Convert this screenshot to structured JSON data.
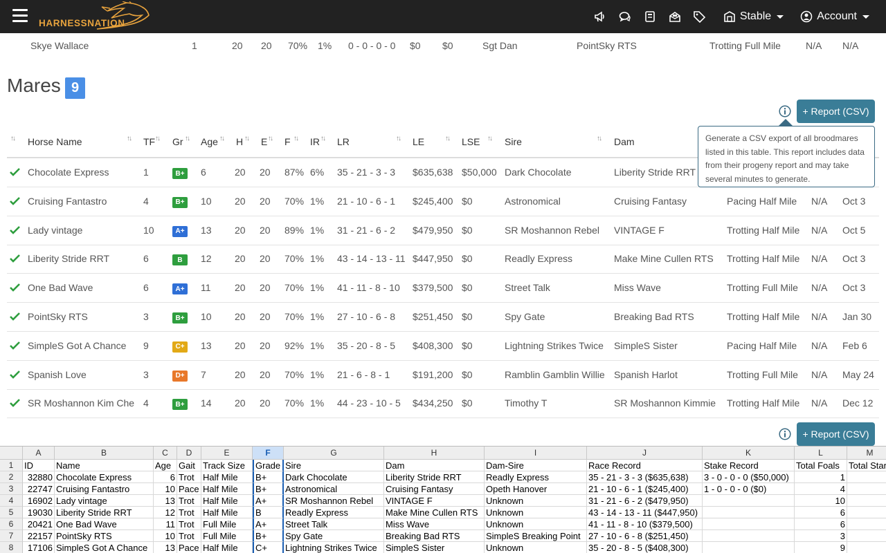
{
  "nav": {
    "logo_text": "HARNESSNATION",
    "stable_label": "Stable",
    "account_label": "Account",
    "icons": [
      "megaphone-icon",
      "chat-icon",
      "notes-icon",
      "inbox-icon",
      "tags-icon",
      "stable-icon",
      "account-icon"
    ]
  },
  "prev_row": {
    "name": "Skye Wallace",
    "tf": "1",
    "h": "20",
    "e": "20",
    "f": "70%",
    "ir": "1%",
    "lr": "0 - 0 - 0 - 0",
    "le": "$0",
    "lse": "$0",
    "sire": "Sgt Dan",
    "dam": "PointSky RTS",
    "track": "Trotting Full Mile",
    "c1": "N/A",
    "c2": "N/A"
  },
  "section": {
    "title": "Mares",
    "count": "9"
  },
  "report_button": "+ Report (CSV)",
  "tooltip": "Generate a CSV export of all broodmares listed in this table. This report includes data from their progeny report and may take several minutes to generate.",
  "columns": [
    "Horse Name",
    "TF",
    "Gr",
    "Age",
    "H",
    "E",
    "F",
    "IR",
    "LR",
    "LE",
    "LSE",
    "Sire",
    "Dam"
  ],
  "grade_colors": {
    "B+": "#2e9e3e",
    "B": "#2e9e3e",
    "A+": "#2f6fd6",
    "C+": "#e2a917",
    "D+": "#e8782a"
  },
  "rows": [
    {
      "name": "Chocolate Express",
      "tf": "1",
      "gr": "B+",
      "age": "6",
      "h": "20",
      "e": "20",
      "f": "87%",
      "ir": "6%",
      "lr": "35 - 21 - 3 - 3",
      "le": "$635,638",
      "lse": "$50,000",
      "sire": "Dark Chocolate",
      "dam": "Liberity Stride RRT",
      "track": "",
      "na": "",
      "date": ""
    },
    {
      "name": "Cruising Fantastro",
      "tf": "4",
      "gr": "B+",
      "age": "10",
      "h": "20",
      "e": "20",
      "f": "70%",
      "ir": "1%",
      "lr": "21 - 10 - 6 - 1",
      "le": "$245,400",
      "lse": "$0",
      "sire": "Astronomical",
      "dam": "Cruising Fantasy",
      "track": "Pacing Half Mile",
      "na": "N/A",
      "date": "Oct 3"
    },
    {
      "name": "Lady vintage",
      "tf": "10",
      "gr": "A+",
      "age": "13",
      "h": "20",
      "e": "20",
      "f": "89%",
      "ir": "1%",
      "lr": "31 - 21 - 6 - 2",
      "le": "$479,950",
      "lse": "$0",
      "sire": "SR Moshannon Rebel",
      "dam": "VINTAGE F",
      "track": "Trotting Half Mile",
      "na": "N/A",
      "date": "Oct 5"
    },
    {
      "name": "Liberity Stride RRT",
      "tf": "6",
      "gr": "B",
      "age": "12",
      "h": "20",
      "e": "20",
      "f": "70%",
      "ir": "1%",
      "lr": "43 - 14 - 13 - 11",
      "le": "$447,950",
      "lse": "$0",
      "sire": "Readly Express",
      "dam": "Make Mine Cullen RTS",
      "track": "Trotting Half Mile",
      "na": "N/A",
      "date": "Oct 3"
    },
    {
      "name": "One Bad Wave",
      "tf": "6",
      "gr": "A+",
      "age": "11",
      "h": "20",
      "e": "20",
      "f": "70%",
      "ir": "1%",
      "lr": "41 - 11 - 8 - 10",
      "le": "$379,500",
      "lse": "$0",
      "sire": "Street Talk",
      "dam": "Miss Wave",
      "track": "Trotting Full Mile",
      "na": "N/A",
      "date": "Oct 3"
    },
    {
      "name": "PointSky RTS",
      "tf": "3",
      "gr": "B+",
      "age": "10",
      "h": "20",
      "e": "20",
      "f": "70%",
      "ir": "1%",
      "lr": "27 - 10 - 6 - 8",
      "le": "$251,450",
      "lse": "$0",
      "sire": "Spy Gate",
      "dam": "Breaking Bad RTS",
      "track": "Trotting Half Mile",
      "na": "N/A",
      "date": "Jan 30"
    },
    {
      "name": "SimpleS Got A Chance",
      "tf": "9",
      "gr": "C+",
      "age": "13",
      "h": "20",
      "e": "20",
      "f": "92%",
      "ir": "1%",
      "lr": "35 - 20 - 8 - 5",
      "le": "$408,300",
      "lse": "$0",
      "sire": "Lightning Strikes Twice",
      "dam": "SimpleS Sister",
      "track": "Pacing Half Mile",
      "na": "N/A",
      "date": "Feb 6"
    },
    {
      "name": "Spanish Love",
      "tf": "3",
      "gr": "D+",
      "age": "7",
      "h": "20",
      "e": "20",
      "f": "70%",
      "ir": "1%",
      "lr": "21 - 6 - 8 - 1",
      "le": "$191,200",
      "lse": "$0",
      "sire": "Ramblin Gamblin Willie",
      "dam": "Spanish Harlot",
      "track": "Trotting Full Mile",
      "na": "N/A",
      "date": "May 24"
    },
    {
      "name": "SR Moshannon Kim Che",
      "tf": "4",
      "gr": "B+",
      "age": "14",
      "h": "20",
      "e": "20",
      "f": "70%",
      "ir": "1%",
      "lr": "44 - 23 - 10 - 5",
      "le": "$434,250",
      "lse": "$0",
      "sire": "Timothy T",
      "dam": "SR Moshannon Kimmie",
      "track": "Trotting Half Mile",
      "na": "N/A",
      "date": "Dec 12"
    }
  ],
  "sheet": {
    "col_letters": [
      "A",
      "B",
      "C",
      "D",
      "E",
      "F",
      "G",
      "H",
      "I",
      "J",
      "K",
      "L",
      "M"
    ],
    "row_numbers": [
      "1",
      "2",
      "3",
      "4",
      "5",
      "6",
      "7",
      "8"
    ],
    "rows": [
      [
        "ID",
        "Name",
        "Age",
        "Gait",
        "Track Size",
        "Grade",
        "Sire",
        "Dam",
        "Dam-Sire",
        "Race Record",
        "Stake Record",
        "Total Foals",
        "Total Star"
      ],
      [
        "32880",
        "Chocolate Express",
        "6",
        "Trot",
        "Half Mile",
        "B+",
        "Dark Chocolate",
        "Liberity Stride RRT",
        "Readly Express",
        "35 - 21 - 3 - 3 ($635,638)",
        "3 - 0 - 0 - 0 ($50,000)",
        "1",
        ""
      ],
      [
        "22747",
        "Cruising Fantastro",
        "10",
        "Pace",
        "Half Mile",
        "B+",
        "Astronomical",
        "Cruising Fantasy",
        "Opeth Hanover",
        "21 - 10 - 6 - 1 ($245,400)",
        "1 - 0 - 0 - 0 ($0)",
        "4",
        ""
      ],
      [
        "16902",
        "Lady vintage",
        "13",
        "Trot",
        "Half Mile",
        "A+",
        "SR Moshannon Rebel",
        "VINTAGE F",
        "Unknown",
        "31 - 21 - 6 - 2 ($479,950)",
        "",
        "10",
        ""
      ],
      [
        "19030",
        "Liberity Stride RRT",
        "12",
        "Trot",
        "Half Mile",
        "B",
        "Readly Express",
        "Make Mine Cullen RTS",
        "Unknown",
        "43 - 14 - 13 - 11 ($447,950)",
        "",
        "6",
        ""
      ],
      [
        "20421",
        "One Bad Wave",
        "11",
        "Trot",
        "Full Mile",
        "A+",
        "Street Talk",
        "Miss Wave",
        "Unknown",
        "41 - 11 - 8 - 10 ($379,500)",
        "",
        "6",
        ""
      ],
      [
        "22157",
        "PointSky RTS",
        "10",
        "Trot",
        "Full Mile",
        "B+",
        "Spy Gate",
        "Breaking Bad RTS",
        "SimpleS Breaking Point",
        "27 - 10 - 6 - 8 ($251,450)",
        "",
        "3",
        ""
      ],
      [
        "17106",
        "SimpleS Got A Chance",
        "13",
        "Pace",
        "Half Mile",
        "C+",
        "Lightning Strikes Twice",
        "SimpleS Sister",
        "Unknown",
        "35 - 20 - 8 - 5 ($408,300)",
        "",
        "9",
        ""
      ]
    ]
  }
}
